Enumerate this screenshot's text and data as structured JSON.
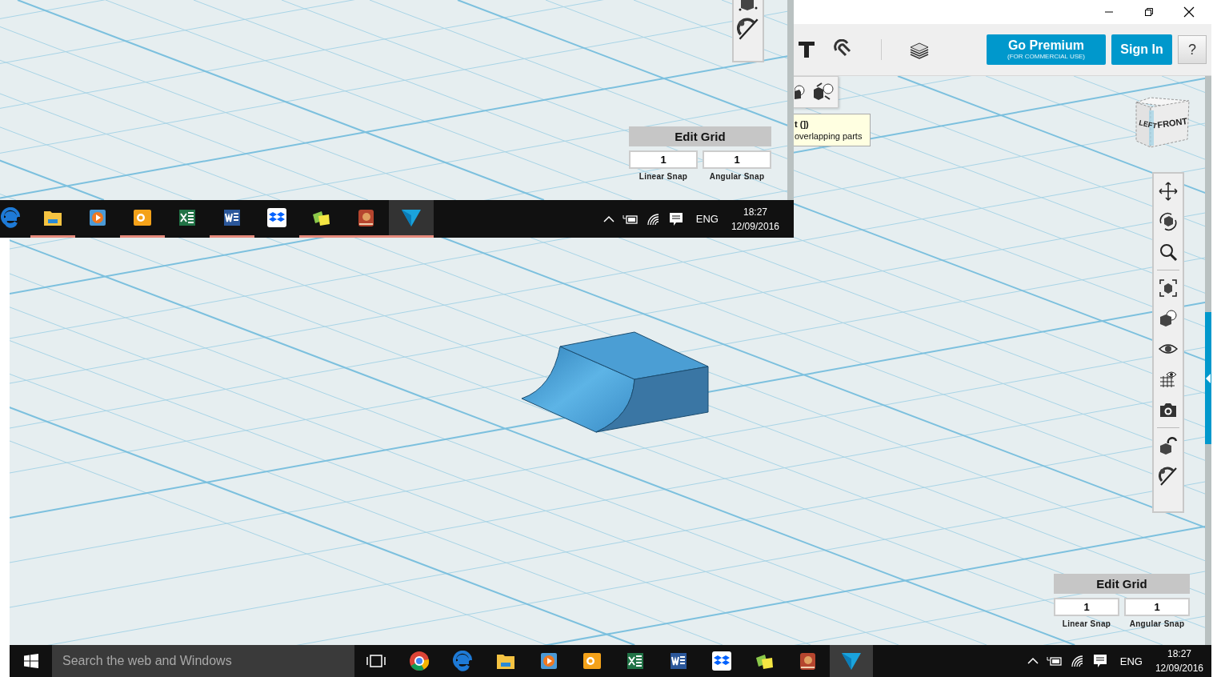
{
  "inset_screenshot": {
    "edit_grid": {
      "title": "Edit Grid",
      "linear_snap": {
        "value": "1",
        "label": "Linear Snap"
      },
      "angular_snap": {
        "value": "1",
        "label": "Angular Snap"
      }
    },
    "taskbar": {
      "apps": [
        {
          "kind": "edge",
          "selected": false,
          "running": false
        },
        {
          "kind": "explorer",
          "selected": false,
          "running": true
        },
        {
          "kind": "media",
          "selected": false,
          "running": false
        },
        {
          "kind": "outlook",
          "selected": false,
          "running": true
        },
        {
          "kind": "excel",
          "selected": false,
          "running": false
        },
        {
          "kind": "word",
          "selected": false,
          "running": true
        },
        {
          "kind": "dropbox",
          "selected": false,
          "running": false
        },
        {
          "kind": "notes",
          "selected": false,
          "running": true
        },
        {
          "kind": "book",
          "selected": false,
          "running": true
        },
        {
          "kind": "design",
          "selected": true,
          "running": true
        }
      ],
      "language": "ENG",
      "time": "18:27",
      "date": "12/09/2016"
    }
  },
  "toolbar": {
    "premium_button": {
      "label": "Go Premium",
      "sublabel": "(FOR COMMERCIAL USE)"
    },
    "sign_in_button": "Sign In",
    "help_button": "?"
  },
  "tooltip": {
    "lines": [
      "t (])",
      "overlapping parts"
    ]
  },
  "view_cube": {
    "faces": [
      "LEFT",
      "FRONT"
    ]
  },
  "edit_grid": {
    "title": "Edit Grid",
    "linear_snap": {
      "value": "1",
      "label": "Linear Snap"
    },
    "angular_snap": {
      "value": "1",
      "label": "Angular Snap"
    }
  },
  "taskbar": {
    "search_placeholder": "Search the web and Windows",
    "apps": [
      {
        "kind": "chrome",
        "selected": false
      },
      {
        "kind": "edge",
        "selected": false
      },
      {
        "kind": "explorer",
        "selected": false
      },
      {
        "kind": "media",
        "selected": false
      },
      {
        "kind": "outlook",
        "selected": false
      },
      {
        "kind": "excel",
        "selected": false
      },
      {
        "kind": "word",
        "selected": false
      },
      {
        "kind": "dropbox",
        "selected": false
      },
      {
        "kind": "notes",
        "selected": false
      },
      {
        "kind": "book",
        "selected": false
      },
      {
        "kind": "design",
        "selected": true
      }
    ],
    "language": "ENG",
    "time": "18:27",
    "date": "12/09/2016"
  }
}
